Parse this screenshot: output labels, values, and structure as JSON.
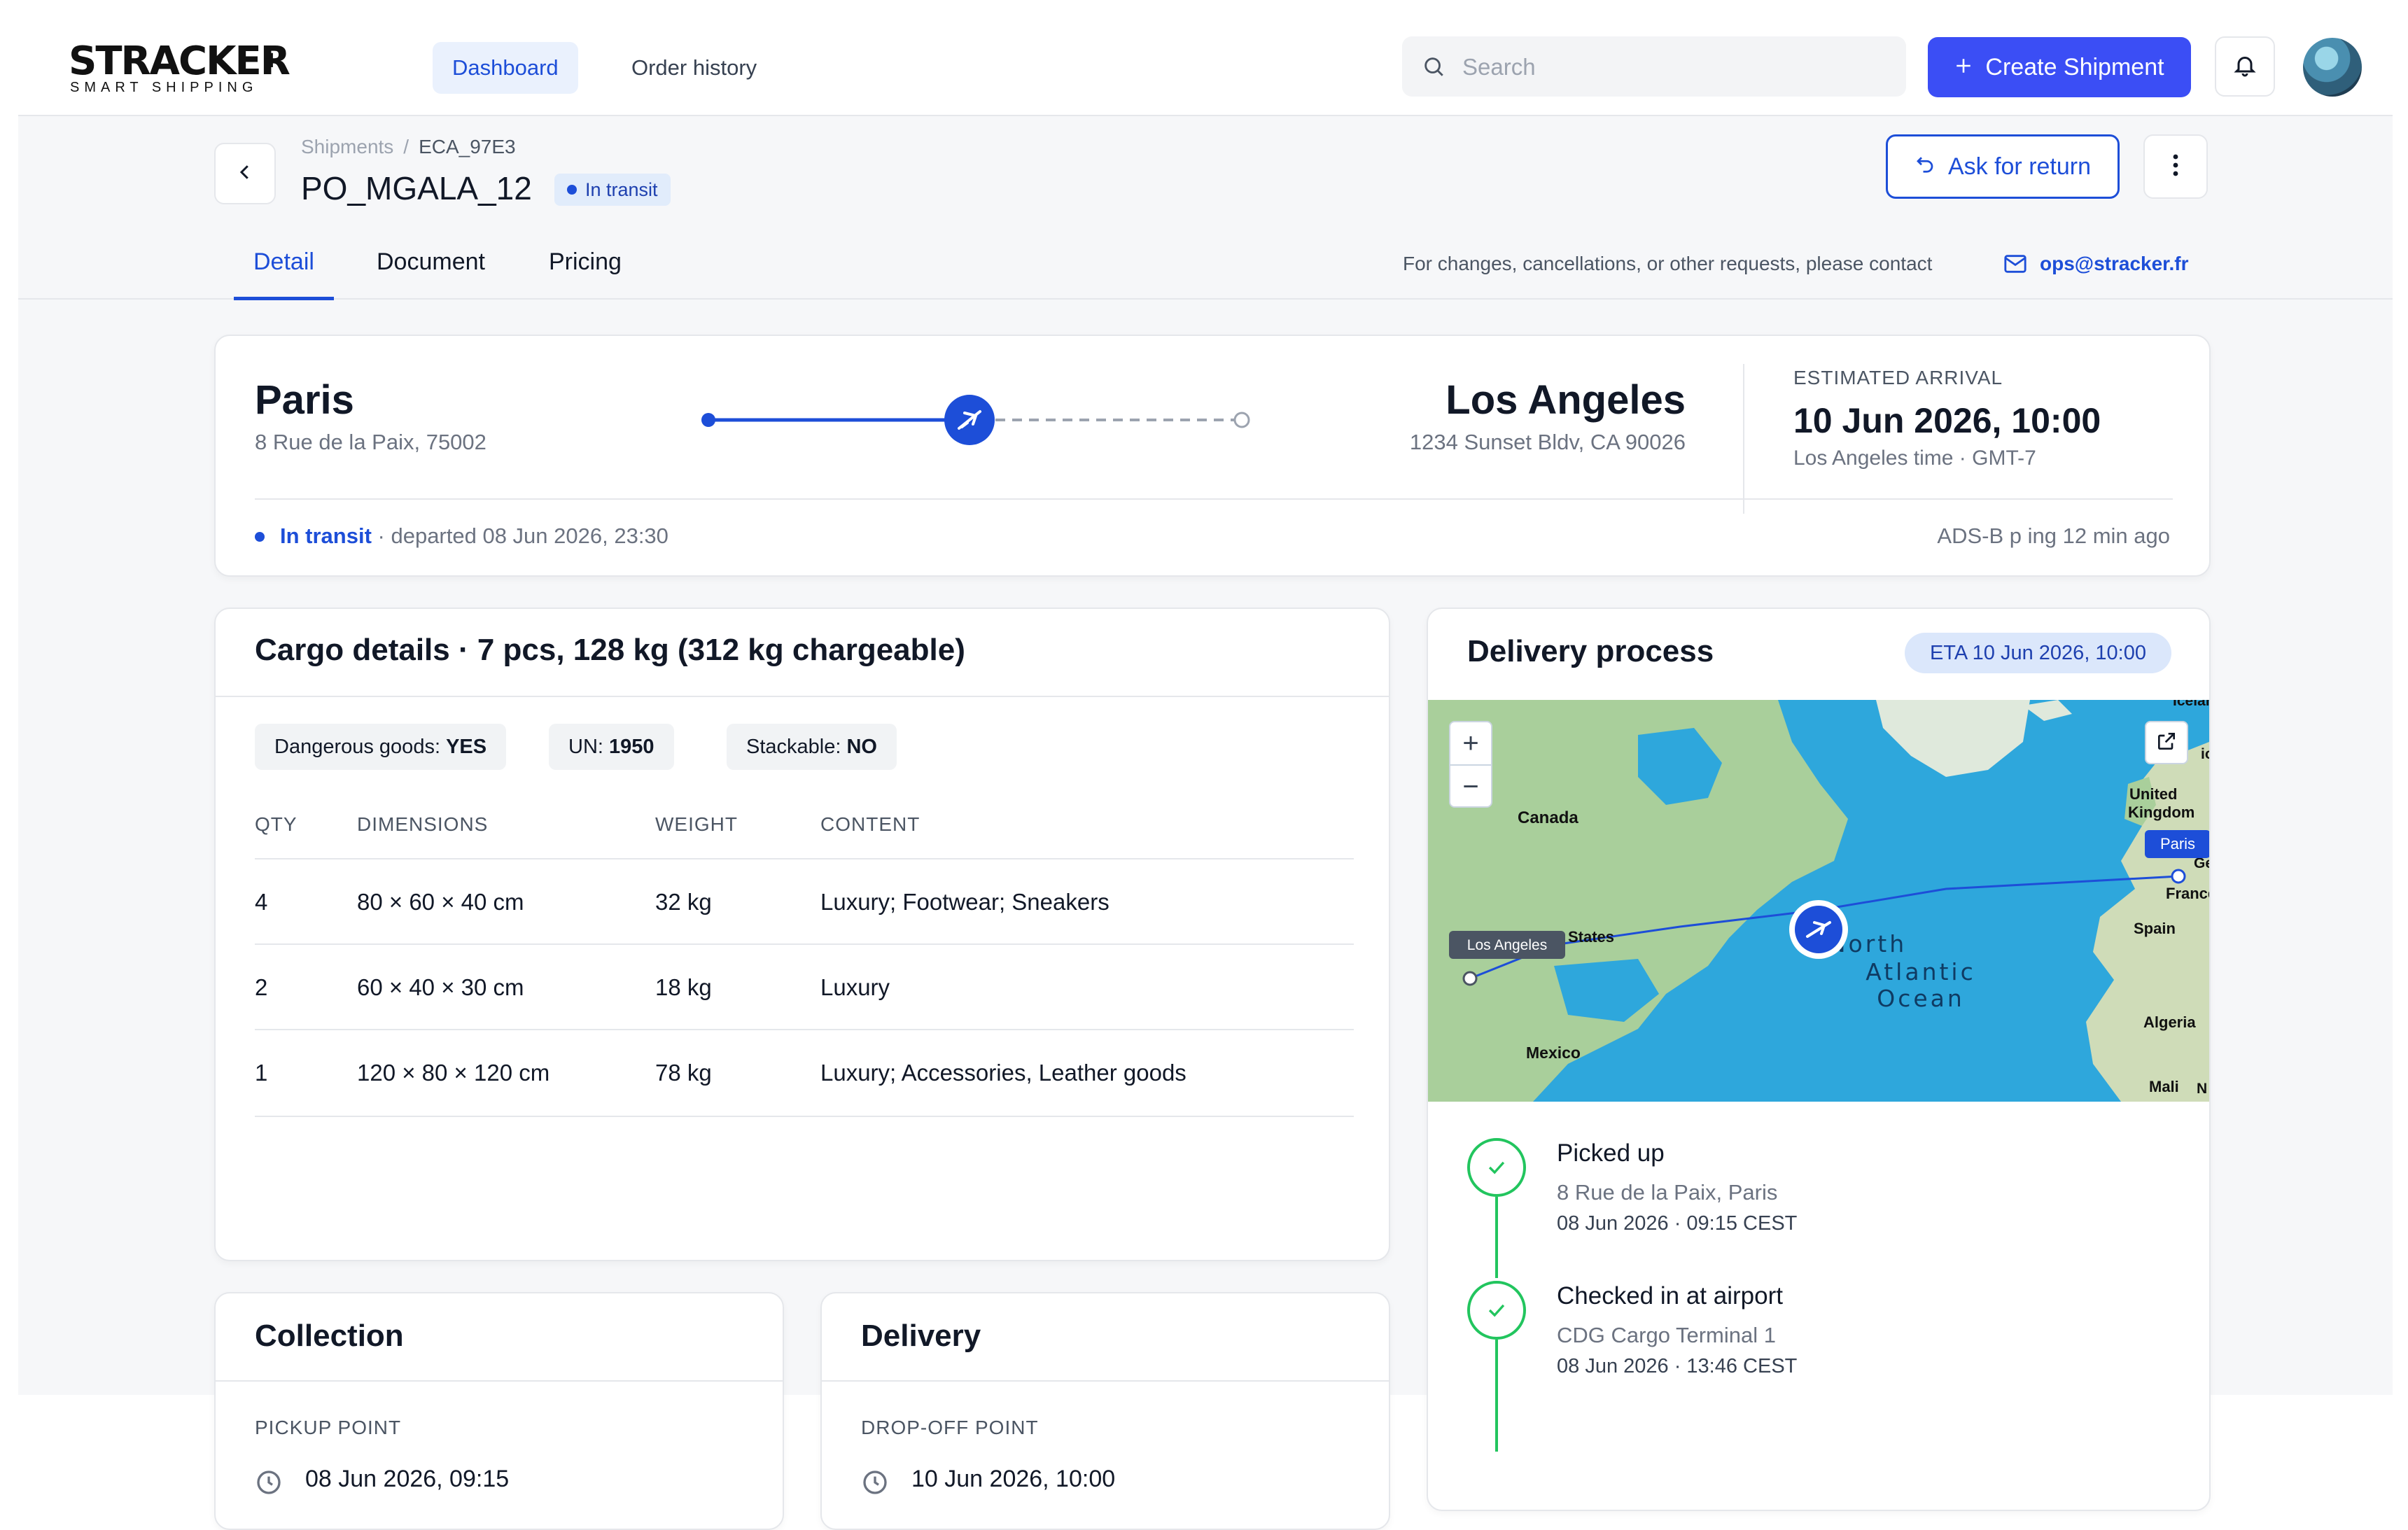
{
  "brand": {
    "name": "STRACKER",
    "tagline": "SMART SHIPPING"
  },
  "nav": {
    "tabs": [
      {
        "label": "Dashboard",
        "active": true
      },
      {
        "label": "Order history",
        "active": false
      }
    ],
    "search_placeholder": "Search",
    "create_label": "Create Shipment"
  },
  "shipment": {
    "breadcrumb": [
      "Shipments",
      "ECA_97E3"
    ],
    "title": "PO_MGALA_12",
    "status": "In transit",
    "return_label": "Ask for return",
    "tabs": [
      "Detail",
      "Document",
      "Pricing"
    ],
    "active_tab": "Detail",
    "contact_note": "For changes, cancellations, or other requests, please contact",
    "contact_email": "ops@stracker.fr"
  },
  "route": {
    "origin_city": "Paris",
    "origin_address": "8 Rue de la Paix, 75002",
    "destination_city": "Los Angeles",
    "destination_address": "1234 Sunset Bldv, CA 90026",
    "progress": 0.5,
    "eta_label": "ESTIMATED ARRIVAL",
    "eta_value": "10 Jun 2026, 10:00",
    "eta_timezone": "Los Angeles time · GMT-7",
    "status": "In transit",
    "departed": "· departed 08 Jun 2026, 23:30",
    "ping": "ADS-B p ing 12 min ago"
  },
  "cargo": {
    "title": "Cargo details · 7 pcs, 128 kg (312 kg chargeable)",
    "chips": [
      {
        "label": "Dangerous goods:",
        "value": "YES"
      },
      {
        "label": "UN:",
        "value": "1950"
      },
      {
        "label": "Stackable:",
        "value": "NO"
      }
    ],
    "columns": [
      "QTY",
      "DIMENSIONS",
      "WEIGHT",
      "CONTENT"
    ],
    "rows": [
      {
        "qty": "4",
        "dimensions": "80 × 60 × 40 cm",
        "weight": "32 kg",
        "content": "Luxury; Footwear; Sneakers"
      },
      {
        "qty": "2",
        "dimensions": "60 × 40 × 30 cm",
        "weight": "18 kg",
        "content": "Luxury"
      },
      {
        "qty": "1",
        "dimensions": "120 × 80 × 120 cm",
        "weight": "78 kg",
        "content": "Luxury; Accessories, Leather goods"
      }
    ]
  },
  "delivery": {
    "title": "Delivery process",
    "eta_pill": "ETA 10 Jun 2026, 10:00",
    "map": {
      "labels": {
        "iceland": "Iceland",
        "canada": "Canada",
        "uk_1": "United",
        "uk_2": "Kingdom",
        "france": "France",
        "spain": "Spain",
        "states": "States",
        "ocean_1": "North",
        "ocean_2": "Atlantic",
        "ocean_3": "Ocean",
        "algeria": "Algeria",
        "mexico": "Mexico",
        "mali": "Mali",
        "ge": "Ge",
        "ior": "ior",
        "n": "N"
      },
      "pin_origin": "Paris",
      "pin_destination": "Los Angeles"
    },
    "timeline": [
      {
        "name": "Picked up",
        "place": "8 Rue de la Paix, Paris",
        "time": "08 Jun 2026  ·  09:15 CEST"
      },
      {
        "name": "Checked in at airport",
        "place": "CDG Cargo Terminal 1",
        "time": "08 Jun 2026  ·  13:46 CEST"
      }
    ]
  },
  "collection": {
    "title": "Collection",
    "label": "PICKUP POINT",
    "datetime": "08 Jun 2026, 09:15"
  },
  "dropoff": {
    "title": "Delivery",
    "label": "DROP-OFF POINT",
    "datetime": "10 Jun 2026, 10:00"
  },
  "colors": {
    "accent": "#3b4ef5",
    "link": "#1d4ed8",
    "success": "#22c55e",
    "map_water": "#2ea7dc",
    "map_land": "#a9cf9b"
  }
}
